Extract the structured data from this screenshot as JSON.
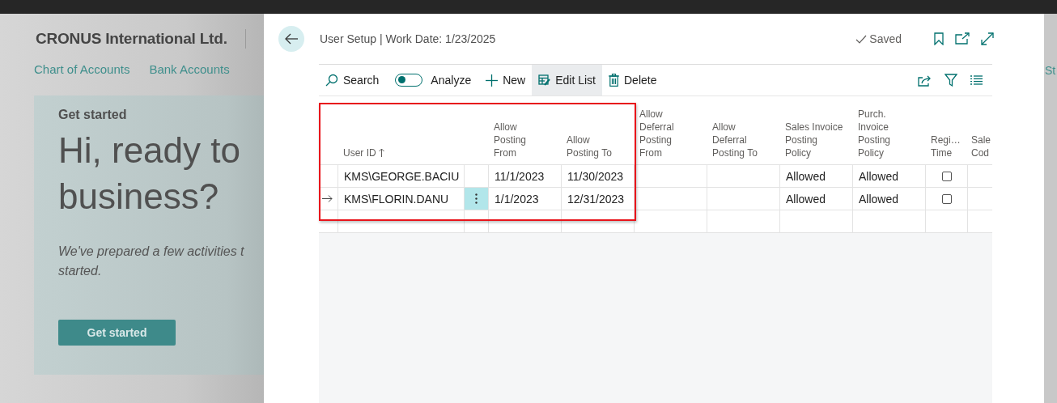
{
  "background": {
    "company": "CRONUS International Ltd.",
    "nav": [
      "Chart of Accounts",
      "Bank Accounts"
    ],
    "card": {
      "heading": "Get started",
      "headline_1": "Hi, ready to",
      "headline_2": "business?",
      "text": "We've prepared a few activities t\nstarted.",
      "button": "Get started"
    },
    "right_link": "St"
  },
  "dialog": {
    "title": "User Setup | Work Date: 1/23/2025",
    "status": "Saved",
    "toolbar": [
      {
        "kind": "search",
        "label": "Search"
      },
      {
        "kind": "toggle",
        "label": "Analyze",
        "on": false
      },
      {
        "kind": "new",
        "label": "New"
      },
      {
        "kind": "edit",
        "label": "Edit List",
        "selected": true
      },
      {
        "kind": "delete",
        "label": "Delete"
      }
    ],
    "table": {
      "columns": [
        {
          "label": "User ID",
          "sorted": true
        },
        {
          "label": "Allow\nPosting\nFrom"
        },
        {
          "label": "Allow\nPosting To"
        },
        {
          "label": "Allow\nDeferral\nPosting\nFrom"
        },
        {
          "label": "Allow\nDeferral\nPosting To"
        },
        {
          "label": "Sales Invoice\nPosting\nPolicy"
        },
        {
          "label": "Purch.\nInvoice\nPosting\nPolicy"
        },
        {
          "label": "Regi…\nTime"
        },
        {
          "label": "Sale\nCod"
        }
      ],
      "rows": [
        {
          "selected": false,
          "user_id": "KMS\\GEORGE.BACIU",
          "allow_posting_from": "11/1/2023",
          "allow_posting_to": "11/30/2023",
          "sales_invoice_posting_policy": "Allowed",
          "purch_invoice_posting_policy": "Allowed",
          "register_time": false
        },
        {
          "selected": true,
          "user_id": "KMS\\FLORIN.DANU",
          "allow_posting_from": "1/1/2023",
          "allow_posting_to": "12/31/2023",
          "sales_invoice_posting_policy": "Allowed",
          "purch_invoice_posting_policy": "Allowed",
          "register_time": false
        }
      ]
    }
  }
}
